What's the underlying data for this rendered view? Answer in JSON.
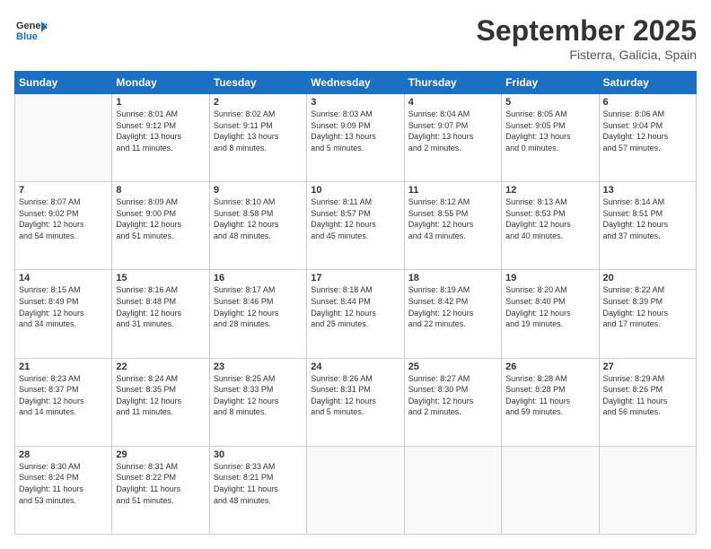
{
  "logo": {
    "general": "General",
    "blue": "Blue"
  },
  "header": {
    "month": "September 2025",
    "location": "Fisterra, Galicia, Spain"
  },
  "weekdays": [
    "Sunday",
    "Monday",
    "Tuesday",
    "Wednesday",
    "Thursday",
    "Friday",
    "Saturday"
  ],
  "weeks": [
    [
      {
        "day": "",
        "info": ""
      },
      {
        "day": "1",
        "info": "Sunrise: 8:01 AM\nSunset: 9:12 PM\nDaylight: 13 hours\nand 11 minutes."
      },
      {
        "day": "2",
        "info": "Sunrise: 8:02 AM\nSunset: 9:11 PM\nDaylight: 13 hours\nand 8 minutes."
      },
      {
        "day": "3",
        "info": "Sunrise: 8:03 AM\nSunset: 9:09 PM\nDaylight: 13 hours\nand 5 minutes."
      },
      {
        "day": "4",
        "info": "Sunrise: 8:04 AM\nSunset: 9:07 PM\nDaylight: 13 hours\nand 2 minutes."
      },
      {
        "day": "5",
        "info": "Sunrise: 8:05 AM\nSunset: 9:05 PM\nDaylight: 13 hours\nand 0 minutes."
      },
      {
        "day": "6",
        "info": "Sunrise: 8:06 AM\nSunset: 9:04 PM\nDaylight: 12 hours\nand 57 minutes."
      }
    ],
    [
      {
        "day": "7",
        "info": "Sunrise: 8:07 AM\nSunset: 9:02 PM\nDaylight: 12 hours\nand 54 minutes."
      },
      {
        "day": "8",
        "info": "Sunrise: 8:09 AM\nSunset: 9:00 PM\nDaylight: 12 hours\nand 51 minutes."
      },
      {
        "day": "9",
        "info": "Sunrise: 8:10 AM\nSunset: 8:58 PM\nDaylight: 12 hours\nand 48 minutes."
      },
      {
        "day": "10",
        "info": "Sunrise: 8:11 AM\nSunset: 8:57 PM\nDaylight: 12 hours\nand 45 minutes."
      },
      {
        "day": "11",
        "info": "Sunrise: 8:12 AM\nSunset: 8:55 PM\nDaylight: 12 hours\nand 43 minutes."
      },
      {
        "day": "12",
        "info": "Sunrise: 8:13 AM\nSunset: 8:53 PM\nDaylight: 12 hours\nand 40 minutes."
      },
      {
        "day": "13",
        "info": "Sunrise: 8:14 AM\nSunset: 8:51 PM\nDaylight: 12 hours\nand 37 minutes."
      }
    ],
    [
      {
        "day": "14",
        "info": "Sunrise: 8:15 AM\nSunset: 8:49 PM\nDaylight: 12 hours\nand 34 minutes."
      },
      {
        "day": "15",
        "info": "Sunrise: 8:16 AM\nSunset: 8:48 PM\nDaylight: 12 hours\nand 31 minutes."
      },
      {
        "day": "16",
        "info": "Sunrise: 8:17 AM\nSunset: 8:46 PM\nDaylight: 12 hours\nand 28 minutes."
      },
      {
        "day": "17",
        "info": "Sunrise: 8:18 AM\nSunset: 8:44 PM\nDaylight: 12 hours\nand 25 minutes."
      },
      {
        "day": "18",
        "info": "Sunrise: 8:19 AM\nSunset: 8:42 PM\nDaylight: 12 hours\nand 22 minutes."
      },
      {
        "day": "19",
        "info": "Sunrise: 8:20 AM\nSunset: 8:40 PM\nDaylight: 12 hours\nand 19 minutes."
      },
      {
        "day": "20",
        "info": "Sunrise: 8:22 AM\nSunset: 8:39 PM\nDaylight: 12 hours\nand 17 minutes."
      }
    ],
    [
      {
        "day": "21",
        "info": "Sunrise: 8:23 AM\nSunset: 8:37 PM\nDaylight: 12 hours\nand 14 minutes."
      },
      {
        "day": "22",
        "info": "Sunrise: 8:24 AM\nSunset: 8:35 PM\nDaylight: 12 hours\nand 11 minutes."
      },
      {
        "day": "23",
        "info": "Sunrise: 8:25 AM\nSunset: 8:33 PM\nDaylight: 12 hours\nand 8 minutes."
      },
      {
        "day": "24",
        "info": "Sunrise: 8:26 AM\nSunset: 8:31 PM\nDaylight: 12 hours\nand 5 minutes."
      },
      {
        "day": "25",
        "info": "Sunrise: 8:27 AM\nSunset: 8:30 PM\nDaylight: 12 hours\nand 2 minutes."
      },
      {
        "day": "26",
        "info": "Sunrise: 8:28 AM\nSunset: 8:28 PM\nDaylight: 11 hours\nand 59 minutes."
      },
      {
        "day": "27",
        "info": "Sunrise: 8:29 AM\nSunset: 8:26 PM\nDaylight: 11 hours\nand 56 minutes."
      }
    ],
    [
      {
        "day": "28",
        "info": "Sunrise: 8:30 AM\nSunset: 8:24 PM\nDaylight: 11 hours\nand 53 minutes."
      },
      {
        "day": "29",
        "info": "Sunrise: 8:31 AM\nSunset: 8:22 PM\nDaylight: 11 hours\nand 51 minutes."
      },
      {
        "day": "30",
        "info": "Sunrise: 8:33 AM\nSunset: 8:21 PM\nDaylight: 11 hours\nand 48 minutes."
      },
      {
        "day": "",
        "info": ""
      },
      {
        "day": "",
        "info": ""
      },
      {
        "day": "",
        "info": ""
      },
      {
        "day": "",
        "info": ""
      }
    ]
  ]
}
